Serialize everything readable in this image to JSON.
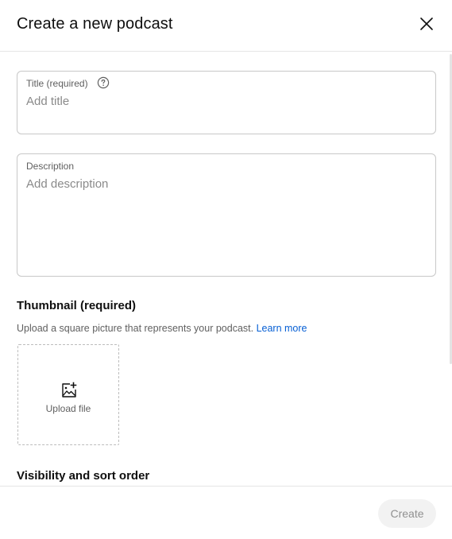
{
  "dialog": {
    "title": "Create a new podcast",
    "close_icon": "close-icon"
  },
  "title_field": {
    "label": "Title (required)",
    "placeholder": "Add title",
    "value": "",
    "help_icon": "help-circle-icon"
  },
  "description_field": {
    "label": "Description",
    "placeholder": "Add description",
    "value": ""
  },
  "thumbnail": {
    "heading": "Thumbnail (required)",
    "description": "Upload a square picture that represents your podcast.",
    "learn_more": "Learn more",
    "upload_label": "Upload file",
    "upload_icon": "add-image-icon"
  },
  "visibility": {
    "heading": "Visibility and sort order"
  },
  "footer": {
    "create_label": "Create",
    "create_enabled": false
  },
  "colors": {
    "link": "#065fd4",
    "border": "#c8c8c8",
    "disabled_button_bg": "#f2f2f2",
    "disabled_button_text": "#909090"
  }
}
